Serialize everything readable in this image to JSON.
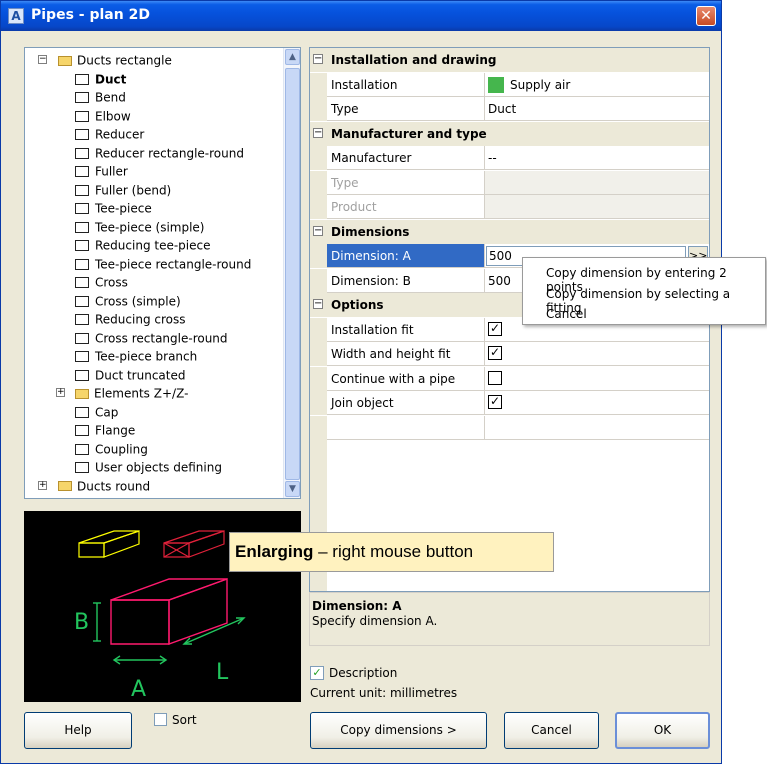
{
  "window": {
    "title": "Pipes - plan 2D",
    "app_icon": "A",
    "close_glyph": "✕"
  },
  "tree": {
    "items": [
      {
        "label": "Ducts rectangle",
        "type": "folder",
        "expander": "−",
        "level": 0
      },
      {
        "label": "Duct",
        "icon": "duct-icon",
        "level": 1,
        "selected": true
      },
      {
        "label": "Bend",
        "icon": "bend-icon",
        "level": 1
      },
      {
        "label": "Elbow",
        "icon": "elbow-icon",
        "level": 1
      },
      {
        "label": "Reducer",
        "icon": "reducer-icon",
        "level": 1
      },
      {
        "label": "Reducer rectangle-round",
        "icon": "reducer-rectangle-round-icon",
        "level": 1
      },
      {
        "label": "Fuller",
        "icon": "fuller-icon",
        "level": 1
      },
      {
        "label": "Fuller (bend)",
        "icon": "fuller-bend-icon",
        "level": 1
      },
      {
        "label": "Tee-piece",
        "icon": "tee-piece-icon",
        "level": 1
      },
      {
        "label": "Tee-piece (simple)",
        "icon": "tee-piece-simple-icon",
        "level": 1
      },
      {
        "label": "Reducing tee-piece",
        "icon": "reducing-tee-piece-icon",
        "level": 1
      },
      {
        "label": "Tee-piece rectangle-round",
        "icon": "tee-piece-rectangle-round-icon",
        "level": 1
      },
      {
        "label": "Cross",
        "icon": "cross-icon",
        "level": 1
      },
      {
        "label": "Cross (simple)",
        "icon": "cross-simple-icon",
        "level": 1
      },
      {
        "label": "Reducing cross",
        "icon": "reducing-cross-icon",
        "level": 1
      },
      {
        "label": "Cross rectangle-round",
        "icon": "cross-rectangle-round-icon",
        "level": 1
      },
      {
        "label": "Tee-piece branch",
        "icon": "tee-piece-branch-icon",
        "level": 1
      },
      {
        "label": "Duct truncated",
        "icon": "duct-truncated-icon",
        "level": 1
      },
      {
        "label": "Elements Z+/Z-",
        "type": "folder",
        "expander": "+",
        "level": 1
      },
      {
        "label": "Cap",
        "icon": "cap-icon",
        "level": 1
      },
      {
        "label": "Flange",
        "icon": "flange-icon",
        "level": 1
      },
      {
        "label": "Coupling",
        "icon": "coupling-icon",
        "level": 1
      },
      {
        "label": "User objects defining",
        "icon": "user-object-icon",
        "level": 1
      },
      {
        "label": "Ducts round",
        "type": "folder",
        "expander": "+",
        "level": 0
      }
    ]
  },
  "preview": {
    "labels": {
      "b": "B",
      "a": "A",
      "l": "L"
    },
    "colors": {
      "background": "#000000",
      "box_yellow": "#ffff00",
      "box_red": "#e0213a",
      "box_magenta": "#ff1a6e",
      "dimension_green": "#22c55e"
    }
  },
  "properties": {
    "sections": [
      {
        "label": "Installation and drawing",
        "rows": [
          {
            "name": "Installation",
            "value": "Supply air",
            "swatch": "#45b64d"
          },
          {
            "name": "Type",
            "value": "Duct"
          }
        ]
      },
      {
        "label": "Manufacturer and type",
        "rows": [
          {
            "name": "Manufacturer",
            "value": "--"
          },
          {
            "name": "Type",
            "value": "",
            "disabled": true
          },
          {
            "name": "Product",
            "value": "",
            "disabled": true
          }
        ]
      },
      {
        "label": "Dimensions",
        "rows": [
          {
            "name": "Dimension: A",
            "value": "500",
            "selected": true,
            "button": ">>"
          },
          {
            "name": "Dimension: B",
            "value": "500"
          }
        ]
      },
      {
        "label": "Options",
        "rows": [
          {
            "name": "Installation fit",
            "checked": true
          },
          {
            "name": "Width and height fit",
            "checked": true
          },
          {
            "name": "Continue with a pipe",
            "checked": false
          },
          {
            "name": "Join object",
            "checked": true
          }
        ]
      }
    ],
    "help": {
      "title": "Dimension: A",
      "description": "Specify dimension A."
    }
  },
  "context_menu": {
    "items": [
      "Copy dimension by entering 2 points",
      "Copy dimension by selecting a fitting",
      "Cancel"
    ]
  },
  "callout": {
    "strong": "Enlarging",
    "rest": " – right mouse button"
  },
  "options": {
    "description_label": "Description",
    "description_checked": true,
    "unit_text": "Current unit: millimetres",
    "sort_label": "Sort",
    "sort_checked": false
  },
  "buttons": {
    "help": "Help",
    "copy_dimensions": "Copy dimensions >",
    "cancel": "Cancel",
    "ok": "OK"
  }
}
